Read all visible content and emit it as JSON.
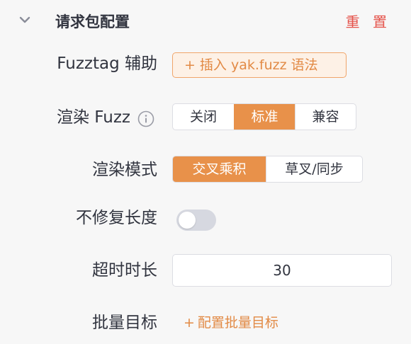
{
  "header": {
    "title": "请求包配置",
    "reset_label": "重 置"
  },
  "fuzztag": {
    "label": "Fuzztag 辅助",
    "button_plus": "+",
    "button_label": "插入 yak.fuzz 语法"
  },
  "render_fuzz": {
    "label": "渲染 Fuzz",
    "options": [
      "关闭",
      "标准",
      "兼容"
    ],
    "selected": "标准"
  },
  "render_mode": {
    "label": "渲染模式",
    "options": [
      "交叉乘积",
      "草叉/同步"
    ],
    "selected": "交叉乘积"
  },
  "no_fix_length": {
    "label": "不修复长度",
    "enabled": false
  },
  "timeout": {
    "label": "超时时长",
    "value": "30"
  },
  "batch_target": {
    "label": "批量目标",
    "link_plus": "+",
    "link_label": "配置批量目标"
  },
  "colors": {
    "accent": "#e8914a",
    "danger": "#e5534b"
  }
}
